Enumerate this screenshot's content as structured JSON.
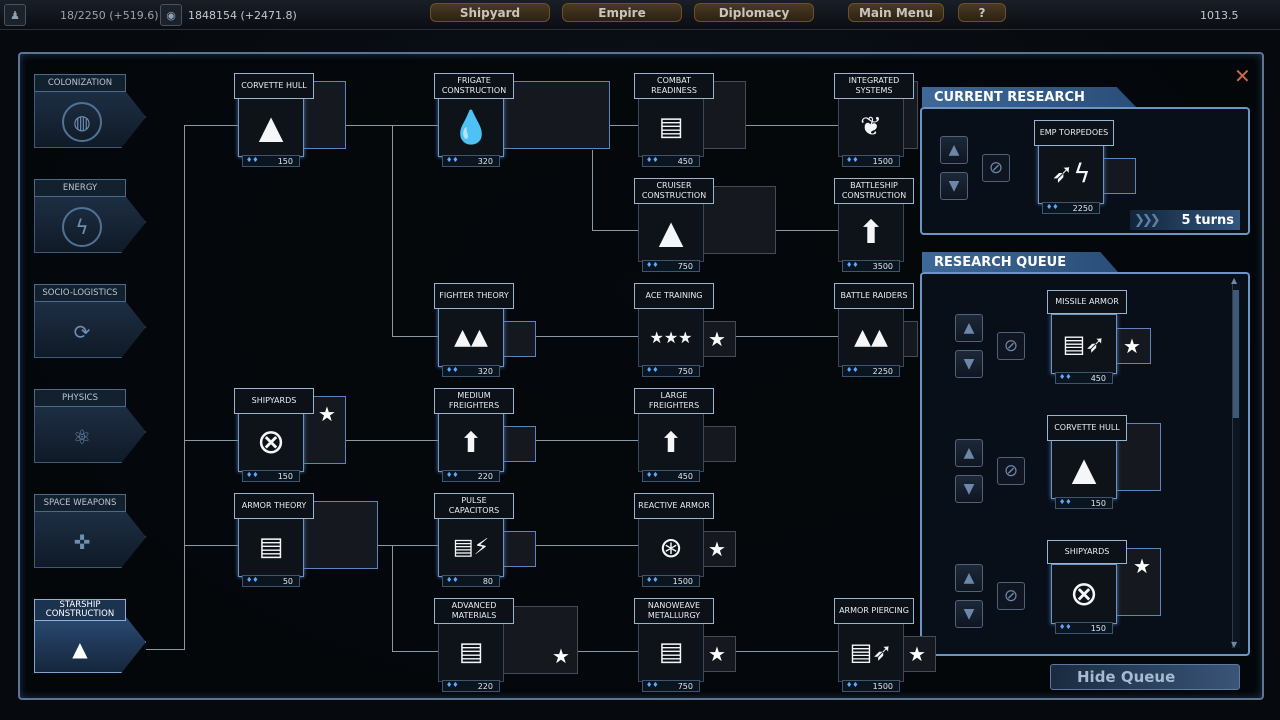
{
  "topbar": {
    "resource1": "18/2250 (+519.6)",
    "resource2": "1848154 (+2471.8)",
    "credits": "1013.5",
    "buttons": [
      "Shipyard",
      "Empire",
      "Diplomacy",
      "Main Menu",
      "?"
    ]
  },
  "categories": [
    {
      "label": "COLONIZATION",
      "icon": "colonization-icon"
    },
    {
      "label": "ENERGY",
      "icon": "lightning-icon"
    },
    {
      "label": "SOCIO-LOGISTICS",
      "icon": "recycle-icon"
    },
    {
      "label": "PHYSICS",
      "icon": "atom-icon"
    },
    {
      "label": "SPACE WEAPONS",
      "icon": "turret-icon"
    },
    {
      "label": "STARSHIP CONSTRUCTION",
      "icon": "ships-icon"
    }
  ],
  "techs": {
    "corvette_hull": {
      "title": "CORVETTE HULL",
      "cost": "150"
    },
    "frigate_construction": {
      "title": "FRIGATE CONSTRUCTION",
      "cost": "320"
    },
    "combat_readiness": {
      "title": "COMBAT READINESS",
      "cost": "450"
    },
    "integrated_systems": {
      "title": "INTEGRATED SYSTEMS",
      "cost": "1500"
    },
    "cruiser_construction": {
      "title": "CRUISER CONSTRUCTION",
      "cost": "750"
    },
    "battleship_construction": {
      "title": "BATTLESHIP CONSTRUCTION",
      "cost": "3500"
    },
    "fighter_theory": {
      "title": "FIGHTER THEORY",
      "cost": "320"
    },
    "ace_training": {
      "title": "ACE TRAINING",
      "cost": "750"
    },
    "battle_raiders": {
      "title": "BATTLE RAIDERS",
      "cost": "2250"
    },
    "shipyards": {
      "title": "SHIPYARDS",
      "cost": "150"
    },
    "medium_freighters": {
      "title": "MEDIUM FREIGHTERS",
      "cost": "220"
    },
    "large_freighters": {
      "title": "LARGE FREIGHTERS",
      "cost": "450"
    },
    "armor_theory": {
      "title": "ARMOR THEORY",
      "cost": "50"
    },
    "pulse_capacitors": {
      "title": "PULSE CAPACITORS",
      "cost": "80"
    },
    "reactive_armor": {
      "title": "REACTIVE ARMOR",
      "cost": "1500"
    },
    "advanced_materials": {
      "title": "ADVANCED MATERIALS",
      "cost": "220"
    },
    "nanoweave_metallurgy": {
      "title": "NANOWEAVE METALLURGY",
      "cost": "750"
    },
    "armor_piercing": {
      "title": "ARMOR PIERCING",
      "cost": "1500"
    }
  },
  "current_research": {
    "header": "CURRENT RESEARCH",
    "title": "EMP TORPEDOES",
    "cost": "2250",
    "turns": "5 turns"
  },
  "research_queue": {
    "header": "RESEARCH QUEUE",
    "items": [
      {
        "title": "MISSILE ARMOR",
        "cost": "450"
      },
      {
        "title": "CORVETTE HULL",
        "cost": "150"
      },
      {
        "title": "SHIPYARDS",
        "cost": "150"
      }
    ]
  },
  "hide_queue": "Hide Queue"
}
